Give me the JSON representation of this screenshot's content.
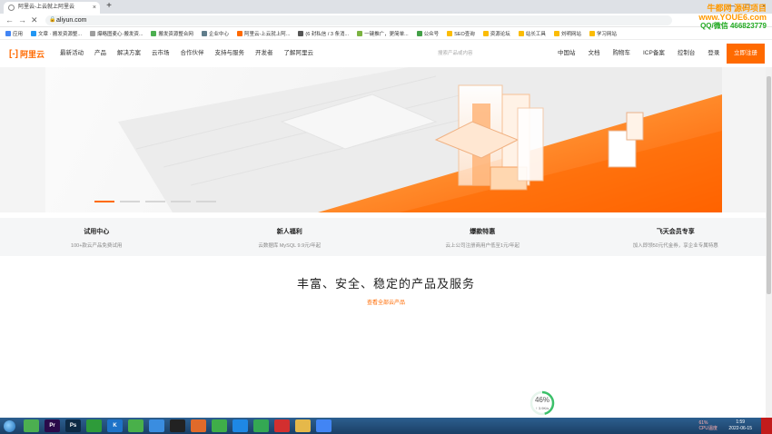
{
  "browser": {
    "tabs": [
      {
        "title": "阿里云-上云就上阿里云",
        "active": true
      },
      {
        "title": "",
        "active": false
      }
    ],
    "newtab": "+",
    "win_controls": [
      "—",
      "□",
      "×"
    ],
    "url": "aliyun.com",
    "bookmarks": [
      "应用",
      "文章 · 搬发资源整...",
      "爆略图麦心·搬发资...",
      "搬发资源整合网",
      "企业中心",
      "阿里云-上云就上阿...",
      "(6 封私信 / 3 条消...",
      "一键推广，更简单...",
      "公众号",
      "SEO查询",
      "资源论坛",
      "站长工具",
      "刘明网站",
      "学习网站"
    ]
  },
  "watermark": {
    "line1": "牛都网 源码项目",
    "line2": "www.YOUE6.com",
    "line3": "QQ/微信 466823779"
  },
  "site": {
    "logo_text": "阿里云",
    "nav": [
      "最新活动",
      "产品",
      "解决方案",
      "云市场",
      "合作伙伴",
      "支持与服务",
      "开发者",
      "了解阿里云"
    ],
    "search_placeholder": "搜索产品或内容",
    "right_nav": [
      "中国站",
      "文档",
      "购物车",
      "ICP备案",
      "控制台",
      "登录"
    ],
    "register": "立即注册"
  },
  "hero": {
    "slides": 5,
    "active_slide": 0
  },
  "features": [
    {
      "title": "试用中心",
      "desc": "100+款云产品免费试用"
    },
    {
      "title": "新人福利",
      "desc": "云数据库 MySQL 9.9元/年起"
    },
    {
      "title": "爆款特惠",
      "desc": "云上公司注册商用户低至1元/年起"
    },
    {
      "title": "飞天会员专享",
      "desc": "加入即领50元代金券，享企业专属特惠"
    }
  ],
  "section": {
    "title": "丰富、安全、稳定的产品及服务",
    "link": "查看全部云产品"
  },
  "gauge": {
    "percent": "46%",
    "speed": "↑ 3.9K/s",
    "value": 0.46
  },
  "taskbar": {
    "apps": [
      {
        "label": "",
        "color": "#4caf50"
      },
      {
        "label": "Pr",
        "color": "#2a0a4a"
      },
      {
        "label": "Ps",
        "color": "#0d2a44"
      },
      {
        "label": "",
        "color": "#2e9b3a"
      },
      {
        "label": "K",
        "color": "#1e73c8"
      },
      {
        "label": "",
        "color": "#49b04a"
      },
      {
        "label": "",
        "color": "#3a8de0"
      },
      {
        "label": "",
        "color": "#222"
      },
      {
        "label": "",
        "color": "#e06a2a"
      },
      {
        "label": "",
        "color": "#3fae49"
      },
      {
        "label": "",
        "color": "#1e88e5"
      },
      {
        "label": "",
        "color": "#34a853"
      },
      {
        "label": "",
        "color": "#d32f2f"
      },
      {
        "label": "",
        "color": "#e5b84a"
      },
      {
        "label": "",
        "color": "#4285f4"
      }
    ],
    "cpu": "61%\nCPU温度",
    "time": "1:59",
    "date": "2022-06-15"
  },
  "colors": {
    "brand": "#ff6a00"
  }
}
